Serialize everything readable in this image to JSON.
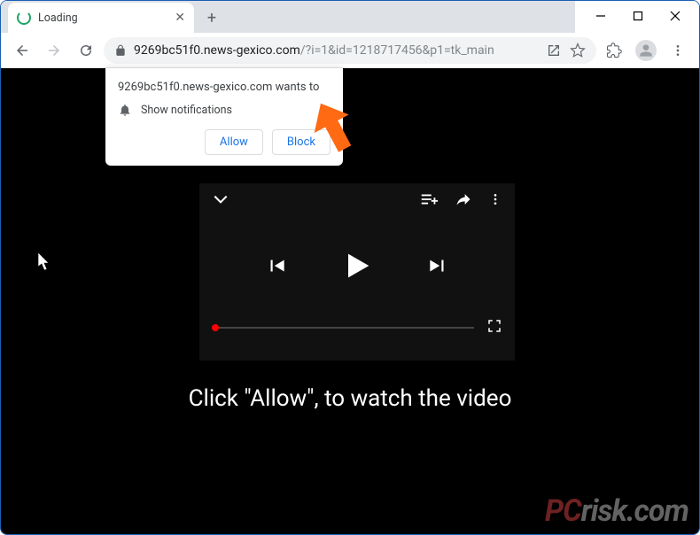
{
  "window": {
    "title": "Loading"
  },
  "titlebar": {
    "dropdown": "⌄",
    "minimize": "—",
    "maximize": "▢",
    "close": "✕"
  },
  "tab": {
    "label": "Loading",
    "close": "✕",
    "newtab": "+"
  },
  "toolbar": {
    "back": "←",
    "forward": "→",
    "reload": "⟳",
    "lock": "🔒",
    "url_host": "9269bc51f0.news-gexico.com",
    "url_path": "/?i=1&id=1218717456&p1=tk_main",
    "share": "↗",
    "star": "☆",
    "extensions": "🧩",
    "menu": "⋮"
  },
  "notification": {
    "line1": "9269bc51f0.news-gexico.com wants to",
    "line2": "Show notifications",
    "allow": "Allow",
    "block": "Block"
  },
  "player": {
    "collapse": "⌄",
    "queue": "≡+",
    "share": "➤",
    "more": "⋮",
    "prev": "⏮",
    "play": "▶",
    "next": "⏭",
    "fullscreen": "⛶"
  },
  "page": {
    "instruction": "Click \"Allow\", to watch the video"
  },
  "watermark": {
    "brand_prefix": "PC",
    "brand_rest": "risk.com"
  }
}
